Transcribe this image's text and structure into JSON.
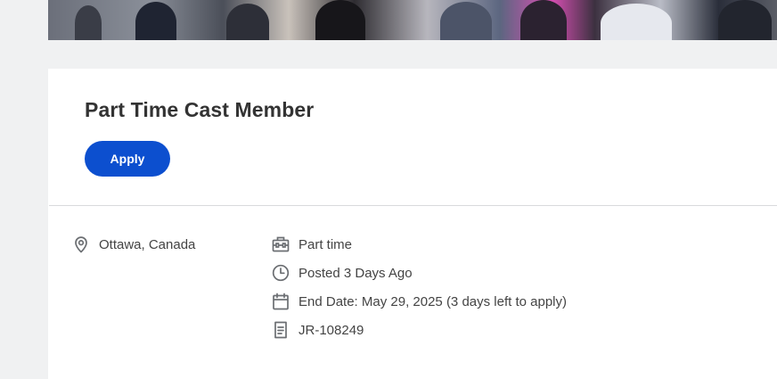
{
  "job": {
    "title": "Part Time Cast Member",
    "apply_label": "Apply"
  },
  "details": {
    "location": "Ottawa, Canada",
    "time_type": "Part time",
    "posted": "Posted 3 Days Ago",
    "end_date": "End Date: May 29, 2025 (3 days left to apply)",
    "requisition_id": "JR-108249"
  },
  "colors": {
    "accent": "#0c4fcf",
    "text": "#333333",
    "page_background": "#f0f1f2"
  },
  "icons": {
    "location": "location-pin-icon",
    "time_type": "briefcase-icon",
    "posted": "clock-icon",
    "end_date": "calendar-icon",
    "requisition_id": "document-icon"
  }
}
